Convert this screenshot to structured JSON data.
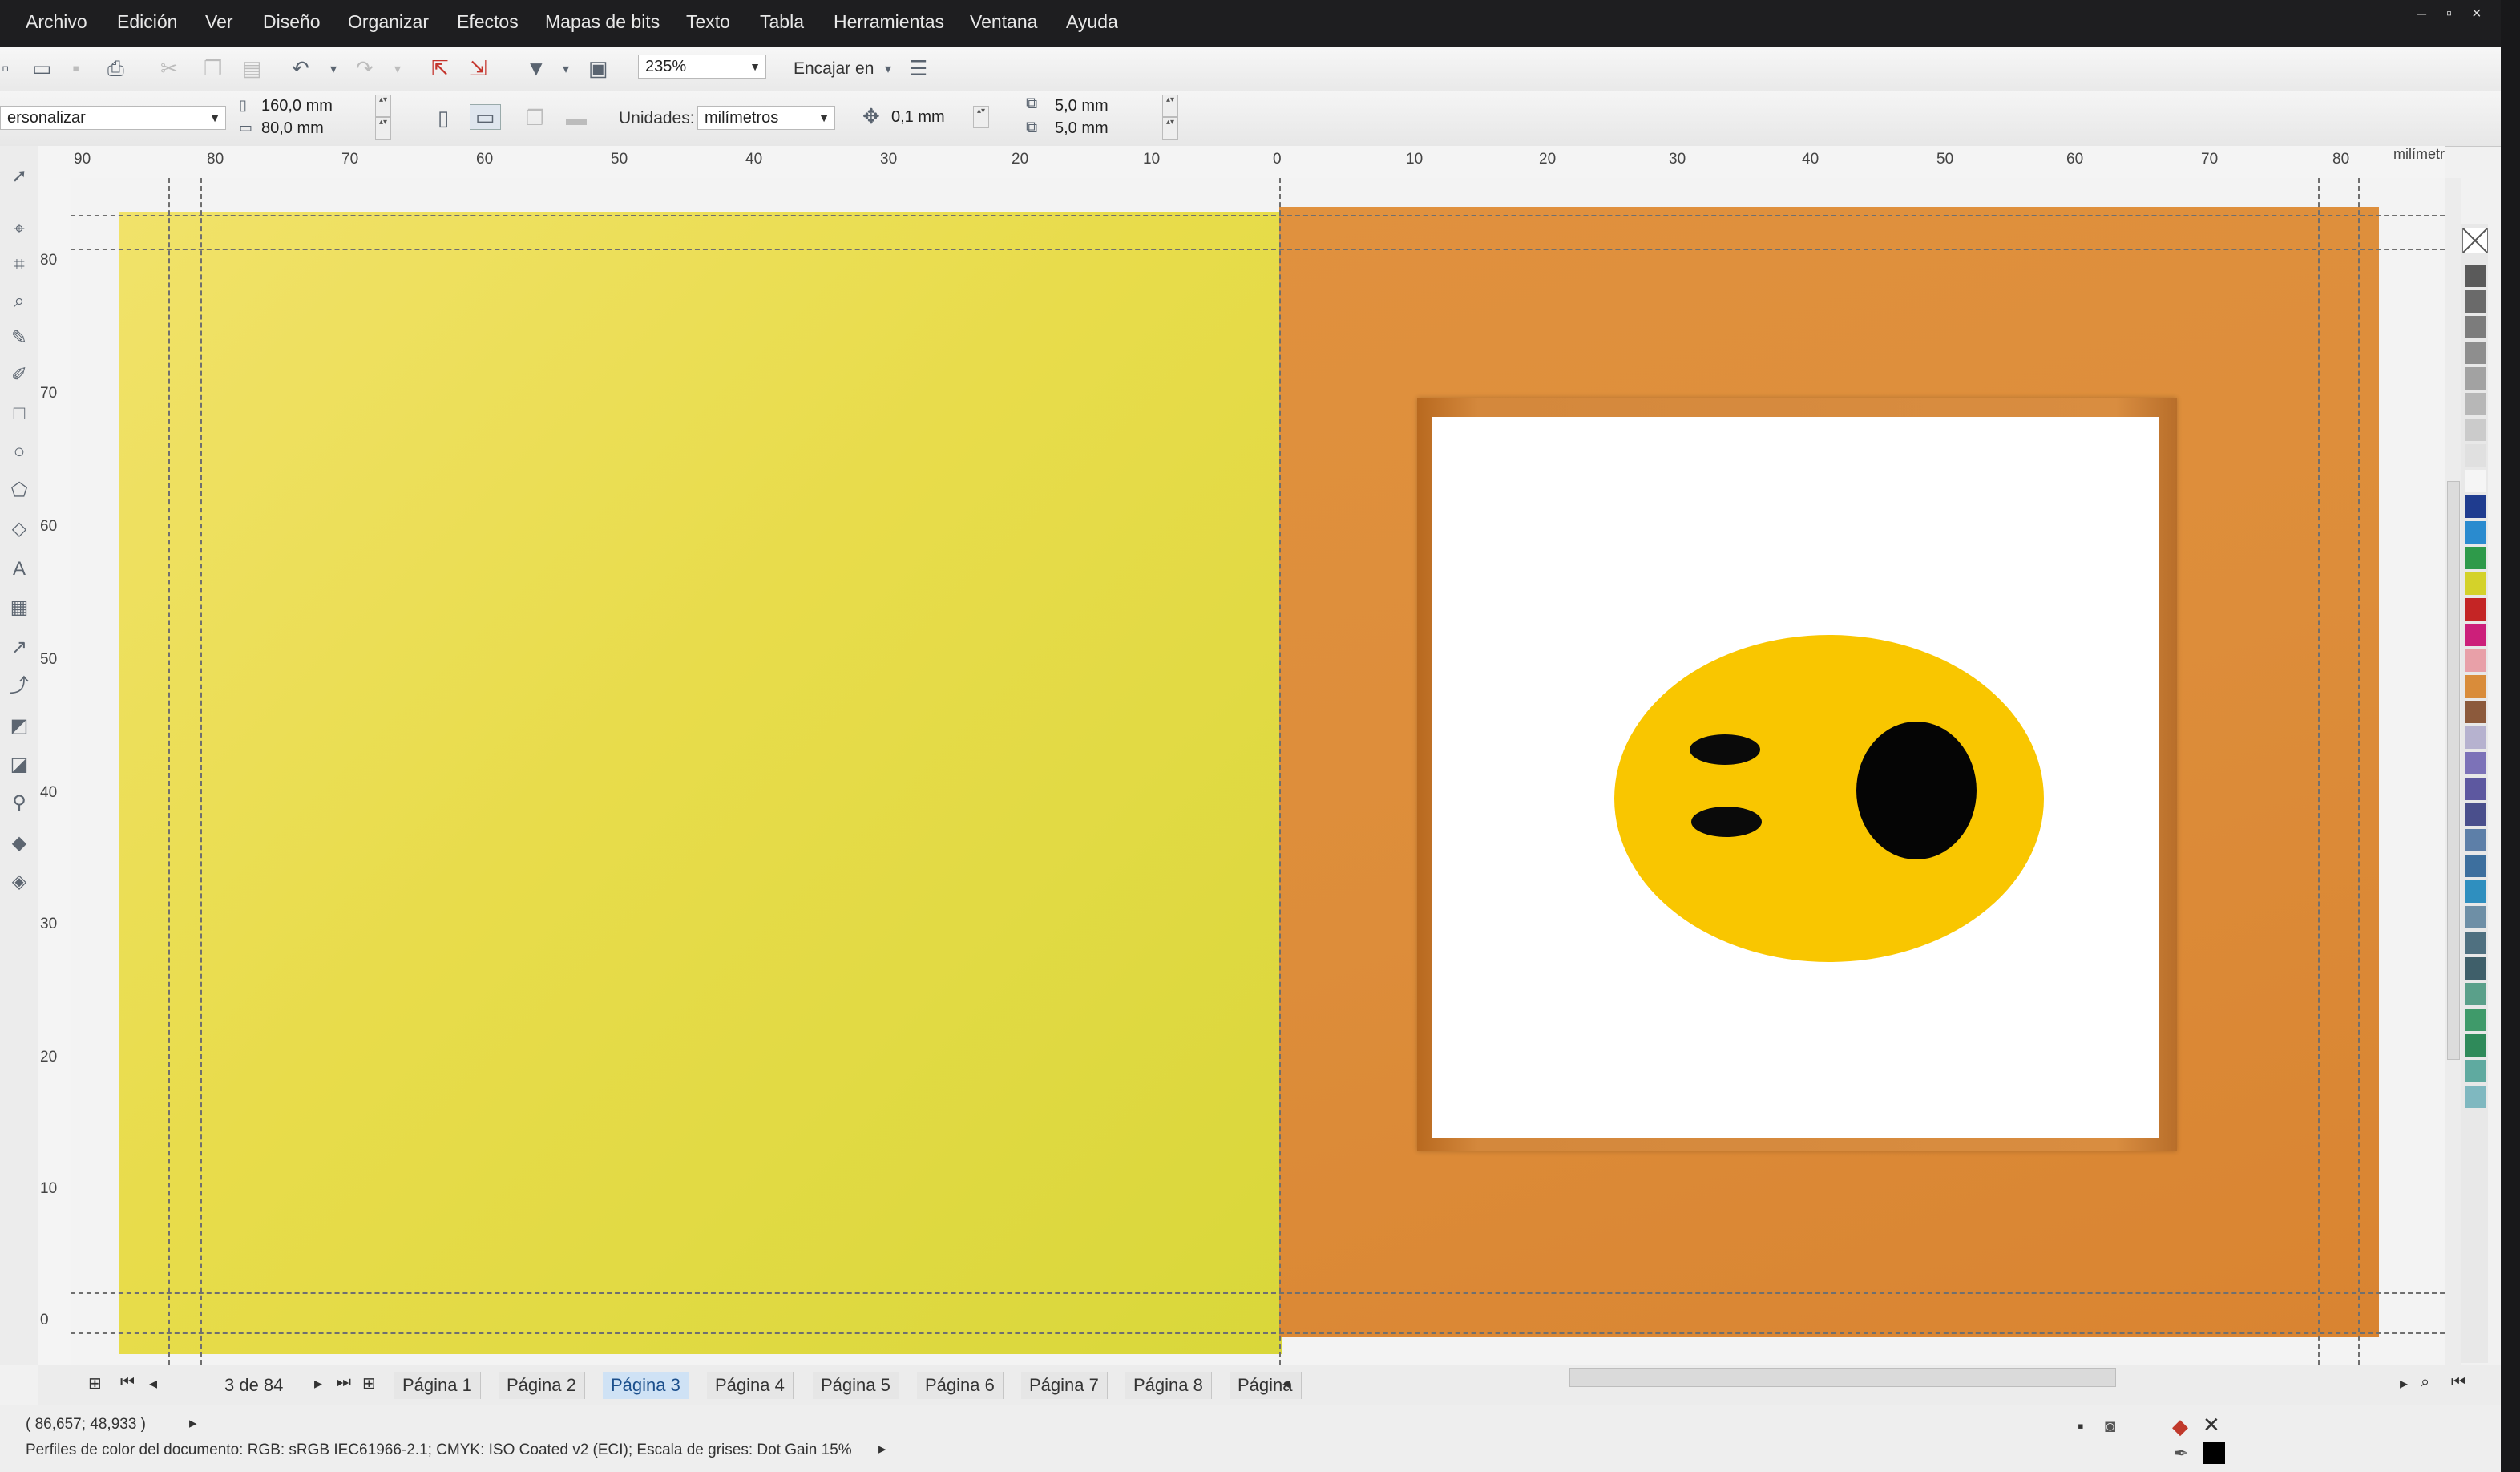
{
  "menu": {
    "items": [
      "Archivo",
      "Edición",
      "Ver",
      "Diseño",
      "Organizar",
      "Efectos",
      "Mapas de bits",
      "Texto",
      "Tabla",
      "Herramientas",
      "Ventana",
      "Ayuda"
    ],
    "window_controls": [
      "–",
      "▫",
      "×"
    ]
  },
  "toolbar": {
    "zoom": "235%",
    "snap_label": "Encajar en"
  },
  "propbar": {
    "preset": "ersonalizar",
    "width": "160,0 mm",
    "height": "80,0 mm",
    "units_label": "Unidades:",
    "units_value": "milímetros",
    "nudge": "0,1 mm",
    "dup_x": "5,0 mm",
    "dup_y": "5,0 mm"
  },
  "ruler": {
    "unit": "milímetros",
    "h_ticks": [
      "90",
      "80",
      "70",
      "60",
      "50",
      "40",
      "30",
      "20",
      "10",
      "0",
      "10",
      "20",
      "30",
      "40",
      "50",
      "60",
      "70",
      "80"
    ],
    "v_ticks": [
      "80",
      "70",
      "60",
      "50",
      "40",
      "30",
      "20",
      "10",
      "0"
    ]
  },
  "pages": {
    "count_label": "3 de 84",
    "tabs": [
      "Página 1",
      "Página 2",
      "Página 3",
      "Página 4",
      "Página 5",
      "Página 6",
      "Página 7",
      "Página 8",
      "Página"
    ],
    "active": "Página 3"
  },
  "status": {
    "coords": "( 86,657; 48,933 )",
    "color_profile": "Perfiles de color del documento: RGB: sRGB IEC61966-2.1; CMYK: ISO Coated v2 (ECI); Escala de grises: Dot Gain 15%"
  },
  "colors": {
    "menubar": "#1e1e20",
    "left_panel": "#e8dc4b",
    "right_panel": "#dd8d3a",
    "face": "#f9c600",
    "palette": [
      "#5a5a5a",
      "#6a6a6a",
      "#7c7c7c",
      "#8e8e8e",
      "#a2a2a2",
      "#b7b7b7",
      "#cbcbcb",
      "#e0e0e0",
      "#f5f5f5",
      "#1f3c8f",
      "#2a8bcf",
      "#2e9a4a",
      "#d4d22a",
      "#c42525",
      "#cc1f7a",
      "#e8a0a8",
      "#d98c3a",
      "#8c5a3c",
      "#b6b2cf",
      "#7c72b8",
      "#5d58a0",
      "#4a4f8c",
      "#5d7fa8",
      "#3d6f9e",
      "#2f8fbf",
      "#6e8fa6",
      "#4f7080",
      "#3f5f6a",
      "#5aa08a",
      "#3f9a6a",
      "#2f8a5a",
      "#5faaa0",
      "#7fb8c0"
    ]
  },
  "icons": {
    "toolbar": [
      "new-icon",
      "open-icon",
      "save-icon",
      "print-icon",
      "cut-icon",
      "copy-icon",
      "paste-icon",
      "undo-icon",
      "redo-icon",
      "import-icon",
      "export-icon",
      "publish-icon",
      "fullscreen-icon"
    ],
    "tools": [
      "pick-icon",
      "shape-icon",
      "crop-icon",
      "zoom-icon",
      "freehand-icon",
      "artistic-media-icon",
      "rectangle-icon",
      "ellipse-icon",
      "polygon-icon",
      "basic-shapes-icon",
      "text-icon",
      "table-icon",
      "dimension-icon",
      "connector-icon",
      "blend-icon",
      "transparency-icon",
      "eyedropper-icon",
      "fill-icon",
      "smart-fill-icon"
    ]
  }
}
